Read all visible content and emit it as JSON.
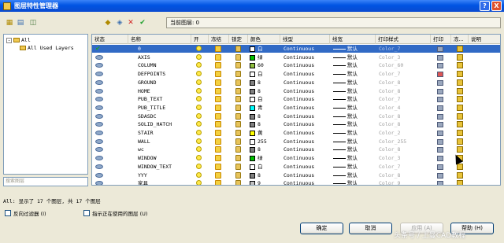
{
  "window": {
    "title": "图层特性管理器",
    "help_symbol": "?",
    "close_symbol": "X"
  },
  "current_layer": "当前图层: 0",
  "tree": {
    "root": "All",
    "child": "All Used Layers",
    "search_placeholder": "搜索图层"
  },
  "columns": [
    "状态",
    "名称",
    "开",
    "冻结",
    "锁定",
    "颜色",
    "线型",
    "线宽",
    "打印样式",
    "打印",
    "冻...",
    "说明"
  ],
  "layers": [
    {
      "name": "0",
      "color_label": "白",
      "color": "#FFFFFF",
      "linetype": "Continuous",
      "lineweight": "默认",
      "plot_style": "Color_7",
      "selected": true
    },
    {
      "name": "AXIS",
      "color_label": "绿",
      "color": "#00C000",
      "linetype": "Continuous",
      "lineweight": "默认",
      "plot_style": "Color_3"
    },
    {
      "name": "COLUMN",
      "color_label": "60",
      "color": "#8FBF3F",
      "linetype": "Continuous",
      "lineweight": "默认",
      "plot_style": "Color_60"
    },
    {
      "name": "DEFPOINTS",
      "color_label": "白",
      "color": "#FFFFFF",
      "linetype": "Continuous",
      "lineweight": "默认",
      "plot_style": "Color_7",
      "no_plot": true
    },
    {
      "name": "GROUND",
      "color_label": "8",
      "color": "#808080",
      "linetype": "Continuous",
      "lineweight": "默认",
      "plot_style": "Color_8"
    },
    {
      "name": "HOME",
      "color_label": "8",
      "color": "#808080",
      "linetype": "Continuous",
      "lineweight": "默认",
      "plot_style": "Color_8"
    },
    {
      "name": "PUB_TEXT",
      "color_label": "白",
      "color": "#FFFFFF",
      "linetype": "Continuous",
      "lineweight": "默认",
      "plot_style": "Color_7"
    },
    {
      "name": "PUB_TITLE",
      "color_label": "青",
      "color": "#00FFFF",
      "linetype": "Continuous",
      "lineweight": "默认",
      "plot_style": "Color_4"
    },
    {
      "name": "SDASDC",
      "color_label": "8",
      "color": "#808080",
      "linetype": "Continuous",
      "lineweight": "默认",
      "plot_style": "Color_8"
    },
    {
      "name": "SOLID_HATCH",
      "color_label": "8",
      "color": "#808080",
      "linetype": "Continuous",
      "lineweight": "默认",
      "plot_style": "Color_8"
    },
    {
      "name": "STAIR",
      "color_label": "黄",
      "color": "#FFFF00",
      "linetype": "Continuous",
      "lineweight": "默认",
      "plot_style": "Color_2"
    },
    {
      "name": "WALL",
      "color_label": "255",
      "color": "#FFFFFF",
      "linetype": "Continuous",
      "lineweight": "默认",
      "plot_style": "Color_255"
    },
    {
      "name": "wc",
      "color_label": "8",
      "color": "#808080",
      "linetype": "Continuous",
      "lineweight": "默认",
      "plot_style": "Color_8"
    },
    {
      "name": "WINDOW",
      "color_label": "绿",
      "color": "#00C000",
      "linetype": "Continuous",
      "lineweight": "默认",
      "plot_style": "Color_3"
    },
    {
      "name": "WINDOW_TEXT",
      "color_label": "白",
      "color": "#FFFFFF",
      "linetype": "Continuous",
      "lineweight": "默认",
      "plot_style": "Color_7"
    },
    {
      "name": "YYY",
      "color_label": "8",
      "color": "#808080",
      "linetype": "Continuous",
      "lineweight": "默认",
      "plot_style": "Color_8"
    },
    {
      "name": "家具",
      "color_label": "9",
      "color": "#C0C0C0",
      "linetype": "Continuous",
      "lineweight": "默认",
      "plot_style": "Color_9"
    }
  ],
  "status_text": "All: 显示了 17 个图层, 共 17 个图层",
  "invert_filter_label": "反向过滤器 (I)",
  "show_used_label": "指示正在使用的图层 (U)",
  "buttons": {
    "ok": "确定",
    "cancel": "取消",
    "apply": "应用 (A)",
    "help": "帮助 (H)"
  },
  "watermark": "头条号 / 上曼CAD教程",
  "colors": {
    "titlebar": "#0054E3",
    "selection": "#316AC5",
    "dialog_bg": "#ECE9D8"
  }
}
